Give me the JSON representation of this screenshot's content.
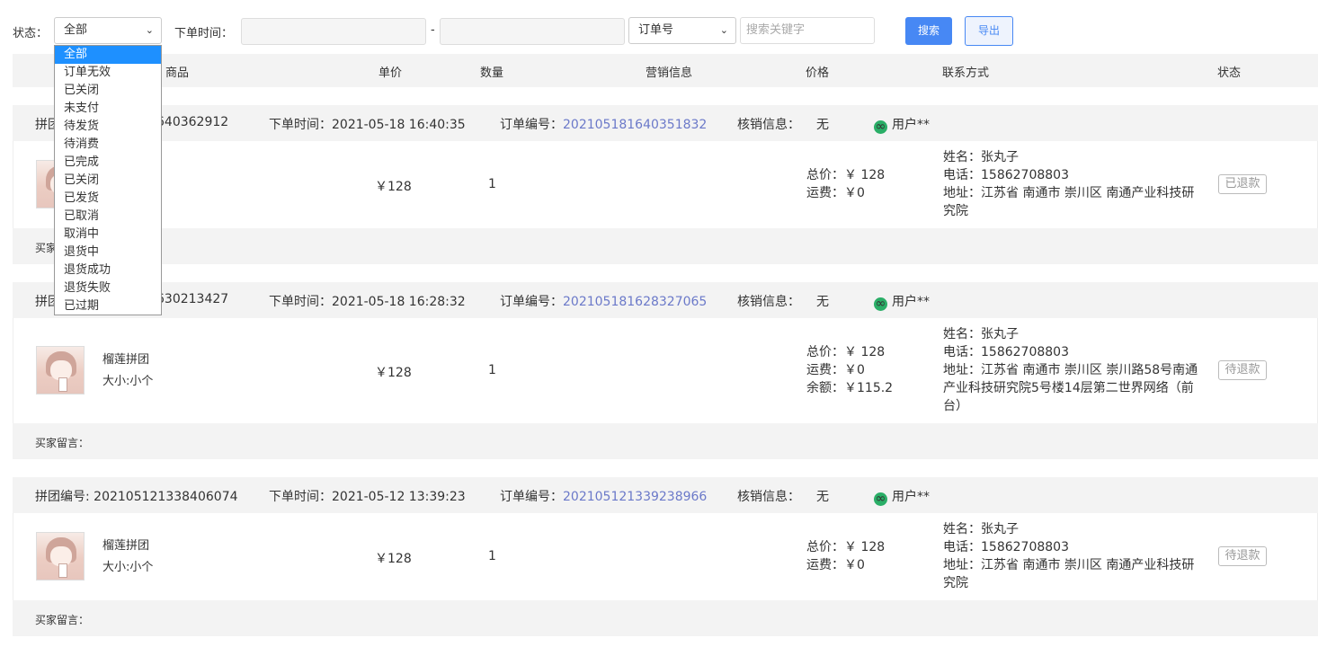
{
  "filter": {
    "status_label": "状态：",
    "status_value": "全部",
    "time_label": "下单时间：",
    "time_separator": "-",
    "field_select_value": "订单号",
    "keyword_placeholder": "搜索关键字",
    "search_button": "搜索",
    "export_button": "导出"
  },
  "status_dropdown_options": [
    "全部",
    "订单无效",
    "已关闭",
    "未支付",
    "待发货",
    "待消费",
    "已完成",
    "已关闭",
    "已发货",
    "已取消",
    "取消中",
    "退货中",
    "退货成功",
    "退货失败",
    "已过期"
  ],
  "table_header": {
    "product": "商品",
    "unit_price": "单价",
    "quantity": "数量",
    "marketing": "营销信息",
    "price": "价格",
    "contact": "联系方式",
    "status": "状态"
  },
  "labels": {
    "group_no": "拼团编号:",
    "order_time": "下单时间：",
    "order_no": "订单编号：",
    "verify_info": "核销信息：",
    "buyer_message": "买家留言：",
    "total": "总价：",
    "shipping": "运费：",
    "balance": "余额：",
    "name": "姓名：",
    "phone": "电话：",
    "address": "地址："
  },
  "orders": [
    {
      "group_no": "202105181640362912",
      "group_no_visible": "640362912",
      "order_time": "2021-05-18 16:40:35",
      "order_no": "202105181640351832",
      "verify": "无",
      "user": "用户**",
      "product_name": "",
      "product_spec": "",
      "unit_price": "￥128",
      "quantity": "1",
      "total": "￥ 128",
      "shipping": "￥0",
      "balance": "",
      "contact_name": "张丸子",
      "contact_phone": "15862708803",
      "contact_address_1": "江苏省 南通市 崇川区 南通产业科技研",
      "contact_address_2": "究院",
      "contact_address_3": "",
      "status": "已退款"
    },
    {
      "group_no": "202105181630213427",
      "group_no_visible": "630213427",
      "order_time": "2021-05-18 16:28:32",
      "order_no": "202105181628327065",
      "verify": "无",
      "user": "用户**",
      "product_name": "榴莲拼团",
      "product_spec": "大小:小个",
      "unit_price": "￥128",
      "quantity": "1",
      "total": "￥ 128",
      "shipping": "￥0",
      "balance": "￥115.2",
      "contact_name": "张丸子",
      "contact_phone": "15862708803",
      "contact_address_1": "江苏省 南通市 崇川区 崇川路58号南通",
      "contact_address_2": "产业科技研究院5号楼14层第二世界网络（前",
      "contact_address_3": "台）",
      "status": "待退款"
    },
    {
      "group_no": "202105121338406074",
      "group_no_visible": "202105121338406074",
      "order_time": "2021-05-12 13:39:23",
      "order_no": "202105121339238966",
      "verify": "无",
      "user": "用户**",
      "product_name": "榴莲拼团",
      "product_spec": "大小:小个",
      "unit_price": "￥128",
      "quantity": "1",
      "total": "￥ 128",
      "shipping": "￥0",
      "balance": "",
      "contact_name": "张丸子",
      "contact_phone": "15862708803",
      "contact_address_1": "江苏省 南通市 崇川区 南通产业科技研",
      "contact_address_2": "究院",
      "contact_address_3": "",
      "status": "待退款"
    }
  ],
  "colors": {
    "primary": "#4788f4",
    "link": "#6b79c9",
    "wechat": "#2aae67",
    "dropdown_active": "#1e90ff"
  }
}
